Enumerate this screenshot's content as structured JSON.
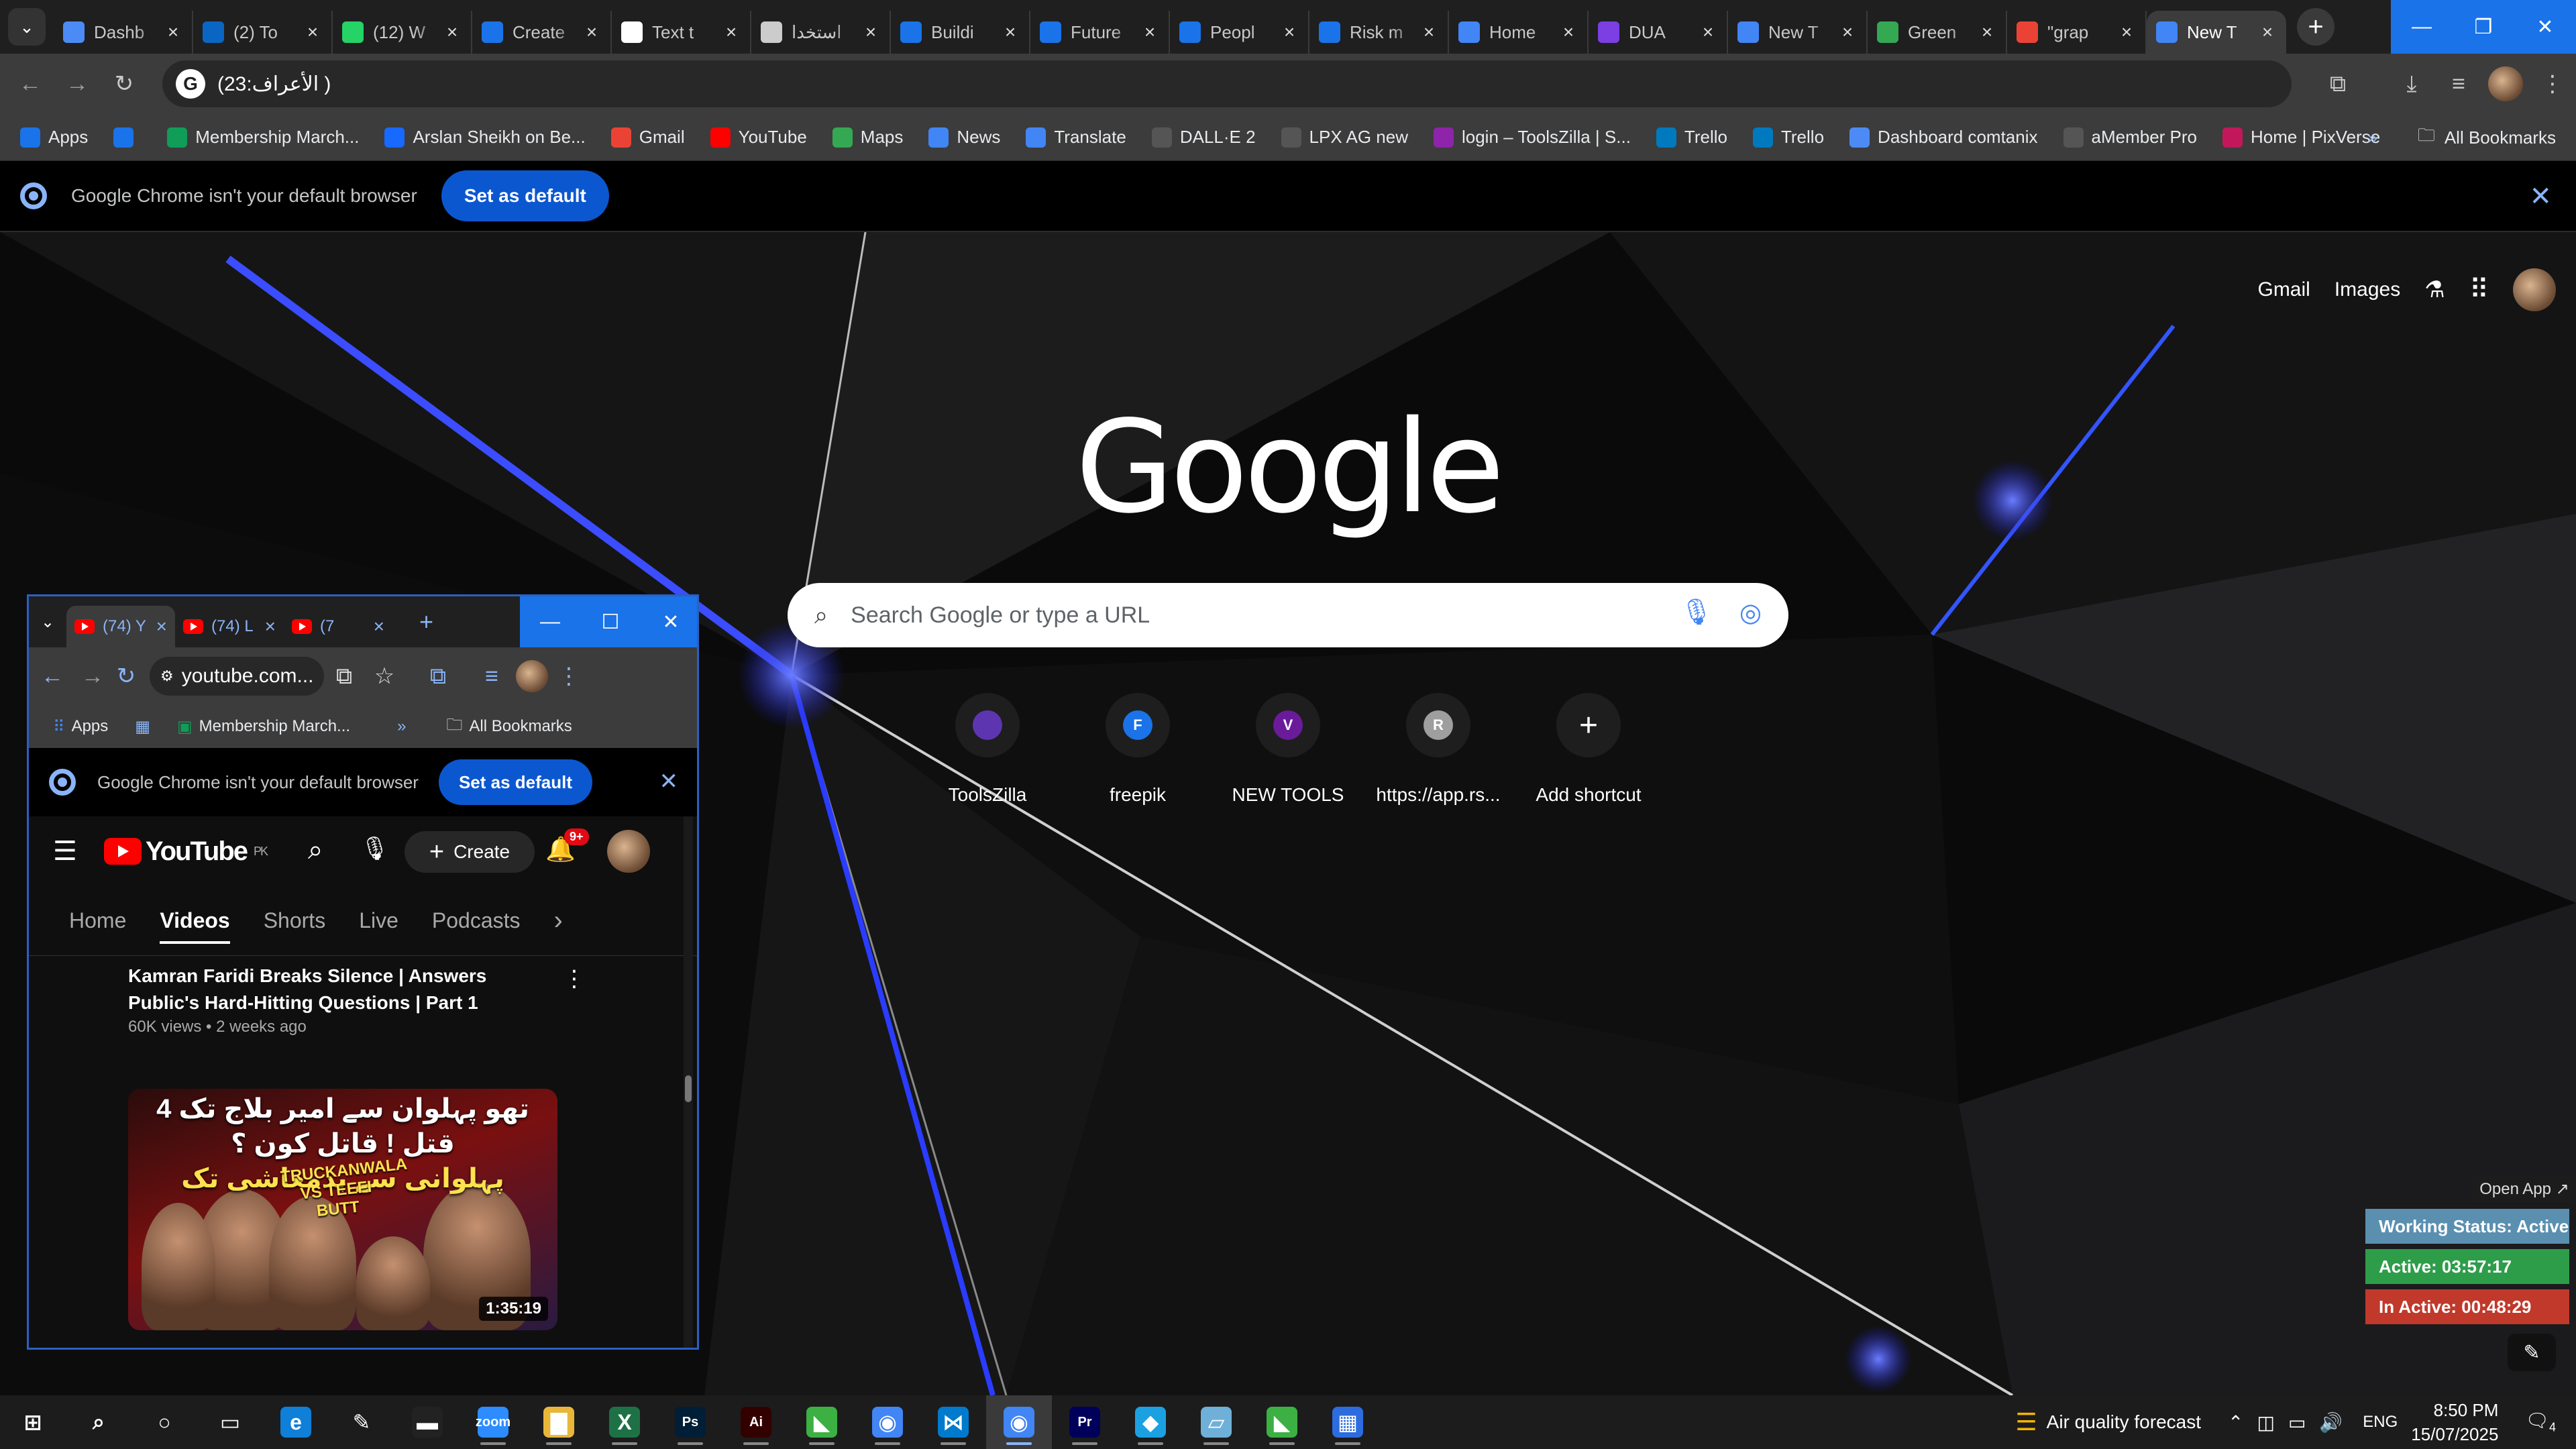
{
  "browser": {
    "tabs": [
      {
        "title": "Dashb",
        "favicon_color": "#4c8bf5",
        "icon": "dashboard-favicon"
      },
      {
        "title": "(2) To",
        "favicon_color": "#0a66c2",
        "icon": "linkedin-favicon"
      },
      {
        "title": "(12) W",
        "favicon_color": "#25d366",
        "icon": "whatsapp-favicon"
      },
      {
        "title": "Create",
        "favicon_color": "#1a73e8",
        "icon": "doc-favicon"
      },
      {
        "title": "Text t",
        "favicon_color": "#ffffff",
        "icon": "text-favicon"
      },
      {
        "title": "استخدا",
        "favicon_color": "#cccccc",
        "icon": "openai-favicon"
      },
      {
        "title": "Buildi",
        "favicon_color": "#1a73e8",
        "icon": "doc-favicon"
      },
      {
        "title": "Future",
        "favicon_color": "#1a73e8",
        "icon": "doc-favicon"
      },
      {
        "title": "Peopl",
        "favicon_color": "#1a73e8",
        "icon": "doc-favicon"
      },
      {
        "title": "Risk m",
        "favicon_color": "#1a73e8",
        "icon": "doc-favicon"
      },
      {
        "title": "Home",
        "favicon_color": "#4285f4",
        "icon": "home-favicon"
      },
      {
        "title": "DUA",
        "favicon_color": "#7b3fe4",
        "icon": "play-favicon"
      },
      {
        "title": "New T",
        "favicon_color": "#4285f4",
        "icon": "chrome-favicon"
      },
      {
        "title": "Green",
        "favicon_color": "#34a853",
        "icon": "leaf-favicon"
      },
      {
        "title": "\"grap",
        "favicon_color": "#ea4335",
        "icon": "gmail-favicon"
      },
      {
        "title": "New T",
        "favicon_color": "#4285f4",
        "icon": "chrome-favicon",
        "active": true
      }
    ],
    "omnibox_text": "(الأعراف:23 )",
    "bookmarks": [
      {
        "label": "Apps",
        "color": "#1a73e8"
      },
      {
        "label": "",
        "color": "#1a73e8"
      },
      {
        "label": "Membership March...",
        "color": "#0f9d58"
      },
      {
        "label": "Arslan Sheikh on Be...",
        "color": "#1769ff"
      },
      {
        "label": "Gmail",
        "color": "#ea4335"
      },
      {
        "label": "YouTube",
        "color": "#ff0000"
      },
      {
        "label": "Maps",
        "color": "#34a853"
      },
      {
        "label": "News",
        "color": "#4285f4"
      },
      {
        "label": "Translate",
        "color": "#4285f4"
      },
      {
        "label": "DALL·E 2",
        "color": "#555555"
      },
      {
        "label": "LPX AG new",
        "color": "#555555"
      },
      {
        "label": "login – ToolsZilla | S...",
        "color": "#8e24aa"
      },
      {
        "label": "Trello",
        "color": "#0079bf"
      },
      {
        "label": "Trello",
        "color": "#0079bf"
      },
      {
        "label": "Dashboard comtanix",
        "color": "#4c8bf5"
      },
      {
        "label": "aMember Pro",
        "color": "#555555"
      },
      {
        "label": "Home | PixVerse",
        "color": "#c2185b"
      }
    ],
    "all_bookmarks": "All Bookmarks",
    "infobar": {
      "message": "Google Chrome isn't your default browser",
      "button": "Set as default"
    }
  },
  "ntp": {
    "links": {
      "gmail": "Gmail",
      "images": "Images"
    },
    "logo": "Google",
    "search_placeholder": "Search Google or type a URL",
    "shortcuts": [
      {
        "label": "ToolsZilla",
        "letter": "",
        "color": "#5e35b1"
      },
      {
        "label": "freepik",
        "letter": "F",
        "color": "#1a73e8"
      },
      {
        "label": "NEW TOOLS",
        "letter": "V",
        "color": "#6a1b9a"
      },
      {
        "label": "https://app.rs...",
        "letter": "R",
        "color": "#9e9e9e"
      },
      {
        "label": "Add shortcut",
        "letter": "+",
        "color": "#1e1e1e"
      }
    ]
  },
  "tracker": {
    "open_app": "Open App ↗",
    "working_status": "Working Status: Active",
    "active": "Active: 03:57:17",
    "inactive": "In Active: 00:48:29",
    "colors": {
      "status": "#5a8fb0",
      "active": "#2e9d4a",
      "inactive": "#c0392b"
    }
  },
  "popup": {
    "tabs": [
      {
        "title": "(74) Y"
      },
      {
        "title": "(74) L"
      },
      {
        "title": "(7"
      }
    ],
    "omnibox_text": "youtube.com...",
    "bookmarks": [
      {
        "label": "Apps"
      },
      {
        "label": "Membership March..."
      }
    ],
    "all_bookmarks": "All Bookmarks",
    "infobar": {
      "message": "Google Chrome isn't your default browser",
      "button": "Set as default"
    },
    "youtube": {
      "logo": "YouTube",
      "region": "PK",
      "create": "Create",
      "notifications": "9+",
      "tabs": [
        "Home",
        "Videos",
        "Shorts",
        "Live",
        "Podcasts"
      ],
      "selected_tab": "Videos",
      "video_title": "Kamran Faridi Breaks Silence | Answers Public's Hard-Hitting Questions | Part 1",
      "video_meta": "60K views • 2 weeks ago",
      "thumb_line1": "تھو پہلوان سے امیر بلاج تک 4 قتل ! قاتل کون ؟",
      "thumb_line2": "پہلوانی سے بدمعاشی تک",
      "thumb_vs": "TRUCKANWALA VS TEEFI BUTT",
      "duration": "1:35:19"
    }
  },
  "taskbar": {
    "apps": [
      {
        "name": "start",
        "color": "#00000000",
        "glyph": "⊞"
      },
      {
        "name": "search",
        "color": "#00000000",
        "glyph": "⌕"
      },
      {
        "name": "cortana",
        "color": "#00000000",
        "glyph": "○"
      },
      {
        "name": "task-view",
        "color": "#00000000",
        "glyph": "▭"
      },
      {
        "name": "edge",
        "color": "#0f7fd8",
        "glyph": "e"
      },
      {
        "name": "pen",
        "color": "#00000000",
        "glyph": "✎"
      },
      {
        "name": "terminal",
        "color": "#222222",
        "glyph": "▬"
      },
      {
        "name": "zoom",
        "color": "#2d8cff",
        "glyph": "zoom"
      },
      {
        "name": "file-explorer",
        "color": "#e8b73a",
        "glyph": "▇"
      },
      {
        "name": "excel",
        "color": "#1e7145",
        "glyph": "X"
      },
      {
        "name": "photoshop",
        "color": "#001e36",
        "glyph": "Ps"
      },
      {
        "name": "illustrator",
        "color": "#330000",
        "glyph": "Ai"
      },
      {
        "name": "green-app",
        "color": "#3cb043",
        "glyph": "◣"
      },
      {
        "name": "chrome",
        "color": "#4285f4",
        "glyph": "◉"
      },
      {
        "name": "vscode",
        "color": "#007acc",
        "glyph": "⋈"
      },
      {
        "name": "chrome-profile",
        "color": "#4285f4",
        "glyph": "◉"
      },
      {
        "name": "premiere",
        "color": "#00005b",
        "glyph": "Pr"
      },
      {
        "name": "blue-app",
        "color": "#1ba1e2",
        "glyph": "◆"
      },
      {
        "name": "notes-app",
        "color": "#6fb0d8",
        "glyph": "▱"
      },
      {
        "name": "green-app-2",
        "color": "#3cb043",
        "glyph": "◣"
      },
      {
        "name": "calculator",
        "color": "#2d6cdf",
        "glyph": "▦"
      }
    ],
    "weather": "Air quality forecast",
    "lang": "ENG",
    "time": "8:50 PM",
    "date": "15/07/2025",
    "notifications": "4"
  }
}
